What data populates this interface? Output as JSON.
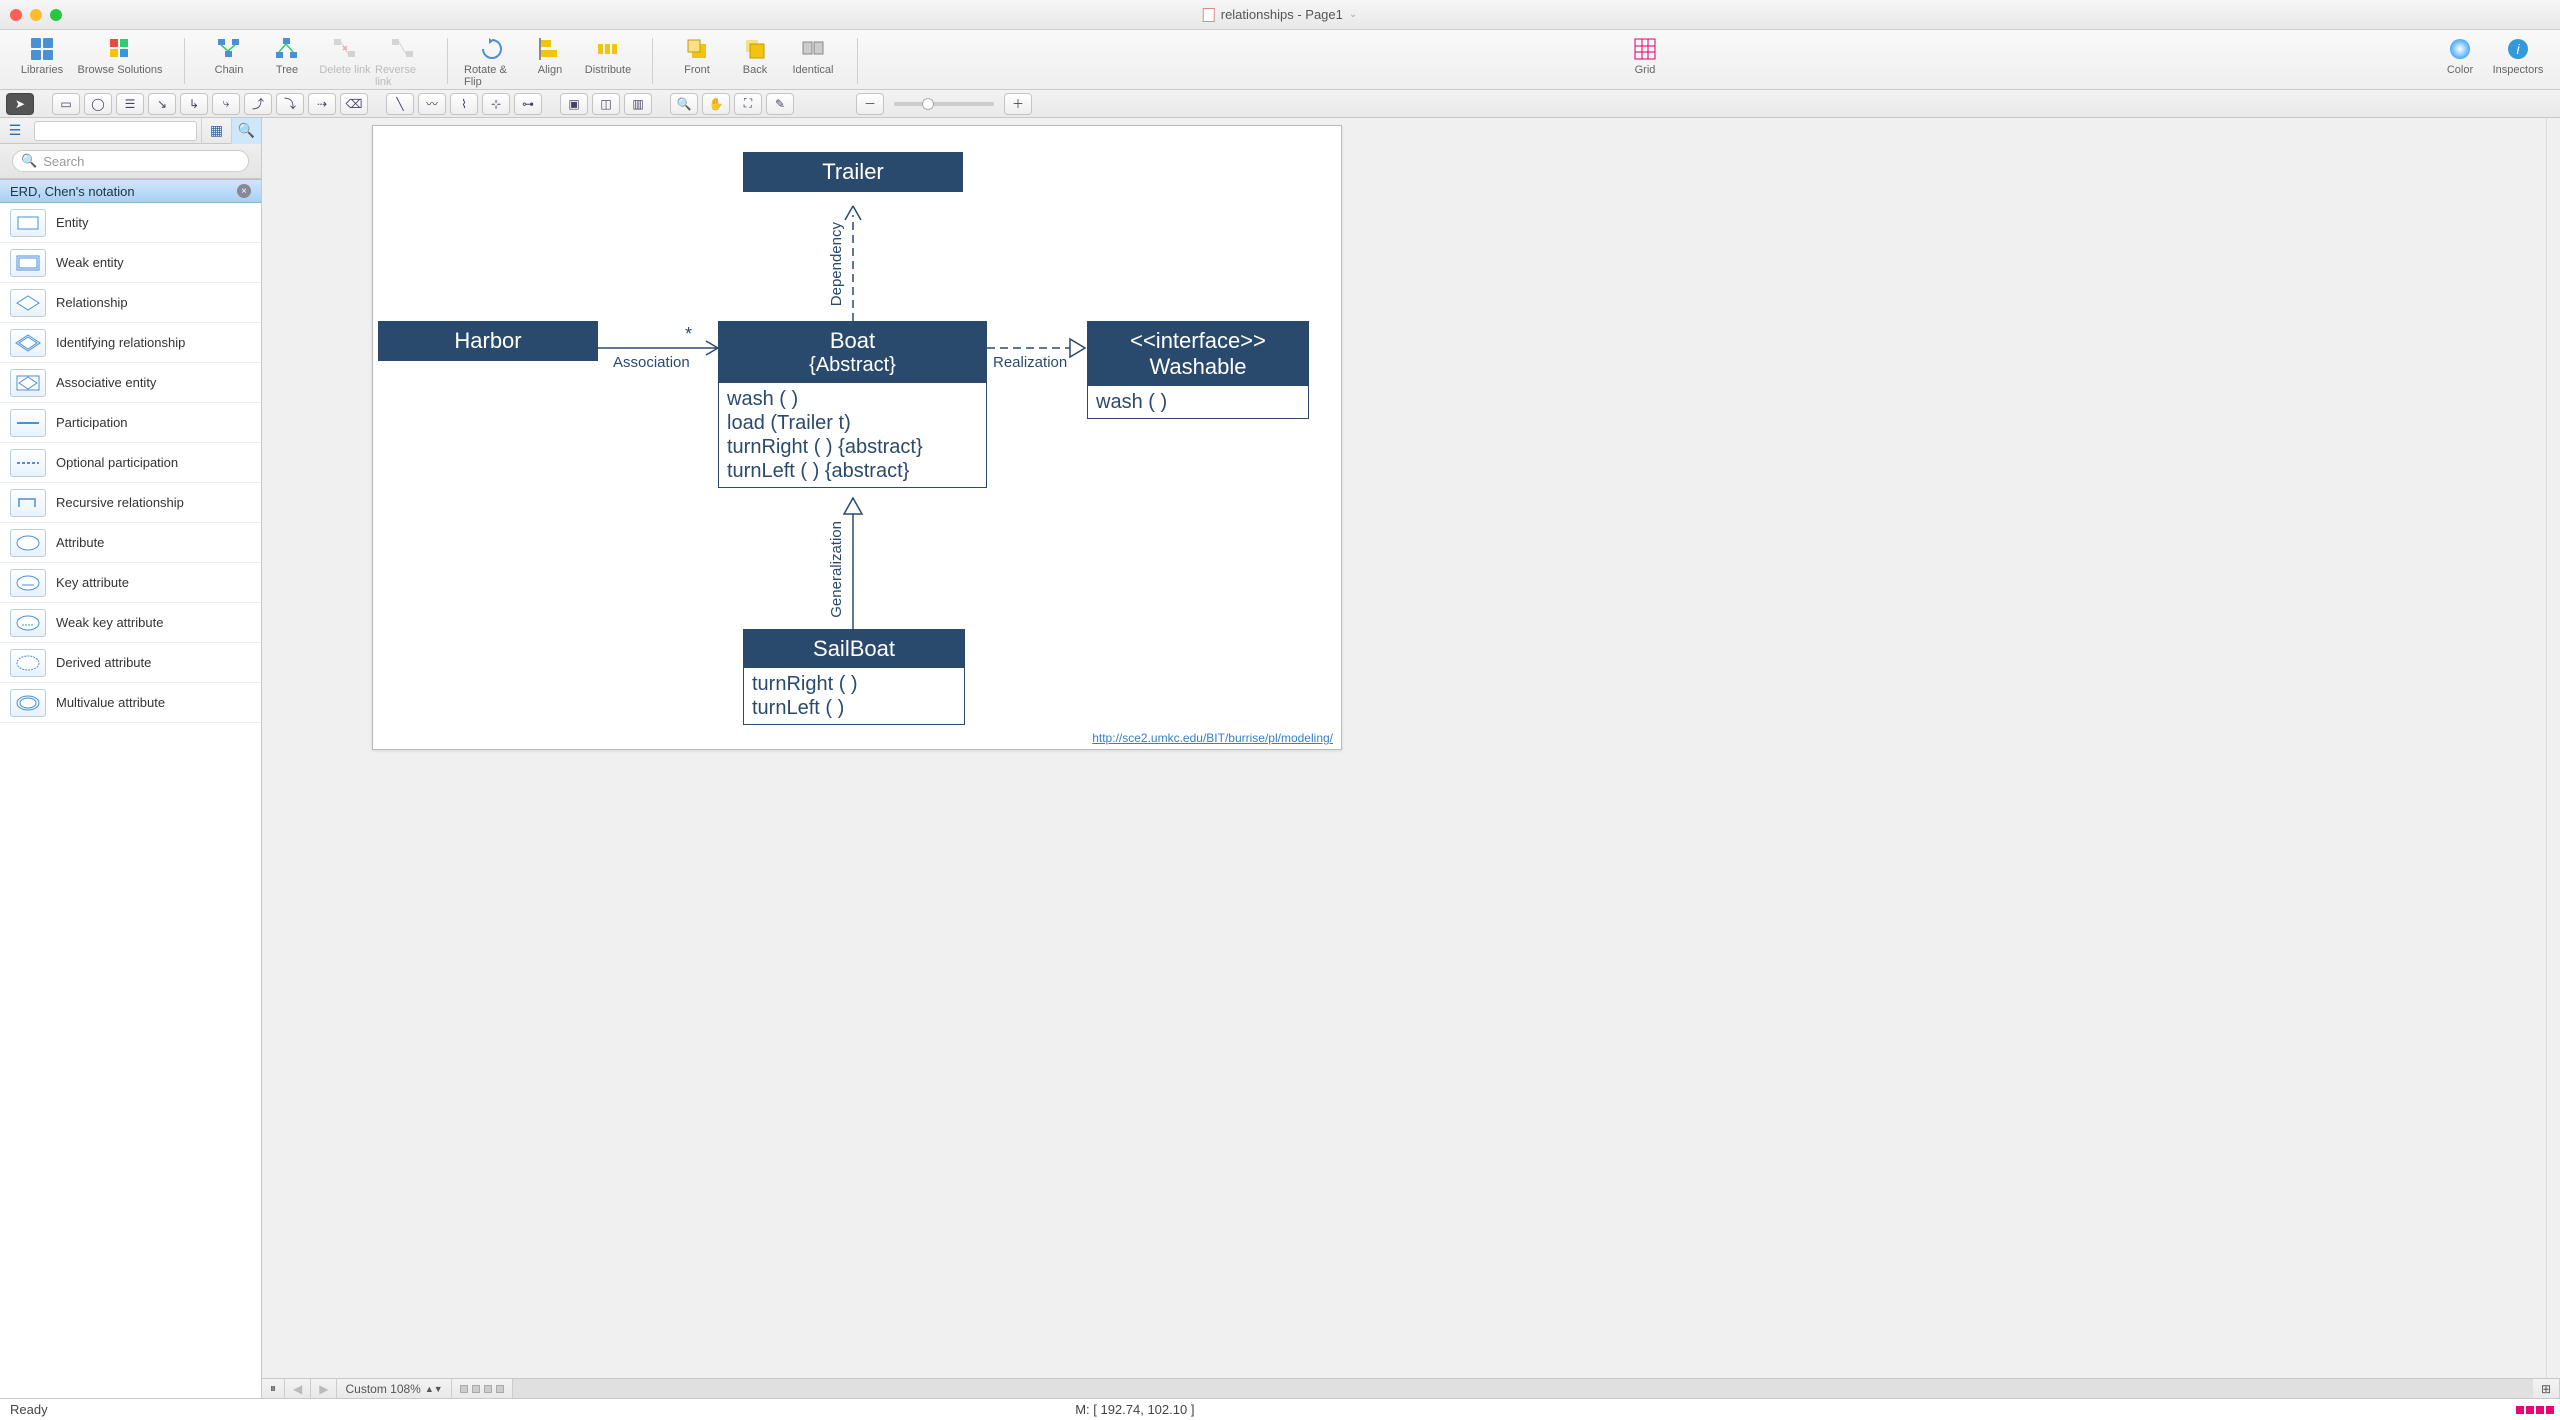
{
  "window": {
    "title": "relationships - Page1"
  },
  "toolbar": {
    "libraries": "Libraries",
    "browse": "Browse Solutions",
    "chain": "Chain",
    "tree": "Tree",
    "delete_link": "Delete link",
    "reverse_link": "Reverse link",
    "rotate_flip": "Rotate & Flip",
    "align": "Align",
    "distribute": "Distribute",
    "front": "Front",
    "back": "Back",
    "identical": "Identical",
    "grid": "Grid",
    "color": "Color",
    "inspectors": "Inspectors"
  },
  "search": {
    "placeholder": "Search"
  },
  "category": {
    "label": "ERD, Chen's notation"
  },
  "stencils": [
    "Entity",
    "Weak entity",
    "Relationship",
    "Identifying relationship",
    "Associative entity",
    "Participation",
    "Optional participation",
    "Recursive relationship",
    "Attribute",
    "Key attribute",
    "Weak key attribute",
    "Derived attribute",
    "Multivalue attribute"
  ],
  "diagram": {
    "trailer": "Trailer",
    "harbor": "Harbor",
    "boat_title": "Boat",
    "boat_sub": "{Abstract}",
    "boat_ops": [
      "wash ( )",
      "load (Trailer t)",
      "turnRight ( ) {abstract}",
      "turnLeft ( ) {abstract}"
    ],
    "iface_stereo": "<<interface>>",
    "iface_name": "Washable",
    "iface_ops": [
      "wash ( )"
    ],
    "sailboat": "SailBoat",
    "sailboat_ops": [
      "turnRight ( )",
      "turnLeft ( )"
    ],
    "lbl_assoc": "Association",
    "lbl_real": "Realization",
    "lbl_dep": "Dependency",
    "lbl_gen": "Generalization",
    "mult": "*",
    "url": "http://sce2.umkc.edu/BIT/burrise/pl/modeling/"
  },
  "pagebar": {
    "zoom": "Custom 108%"
  },
  "status": {
    "ready": "Ready",
    "mouse": "M: [ 192.74, 102.10 ]"
  }
}
